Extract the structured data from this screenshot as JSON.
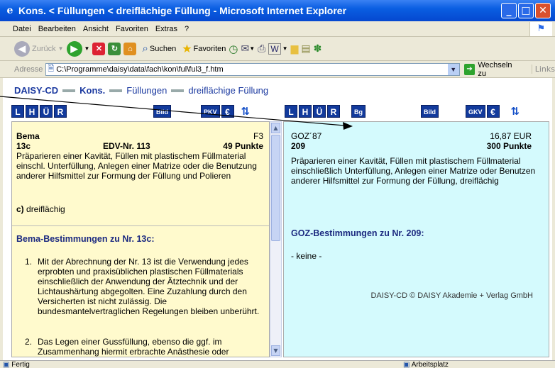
{
  "window": {
    "title": "Kons. < Füllungen < dreiflächige Füllung - Microsoft Internet Explorer"
  },
  "menu": [
    "Datei",
    "Bearbeiten",
    "Ansicht",
    "Favoriten",
    "Extras",
    "?"
  ],
  "toolbar": {
    "back": "Zurück",
    "search": "Suchen",
    "favorites": "Favoriten"
  },
  "address": {
    "label": "Adresse",
    "value": "C:\\Programme\\daisy\\data\\fach\\kon\\ful\\ful3_f.htm",
    "go": "Wechseln zu",
    "links": "Links"
  },
  "breadcrumb": {
    "root": "DAISY-CD",
    "b1": "Kons.",
    "b2": "Füllungen",
    "b3": "dreiflächige Füllung"
  },
  "left_nav": {
    "b1": "L",
    "b2": "H",
    "b3": "Ü",
    "b4": "R",
    "bild": "Bild",
    "pkv": "PKV",
    "euro": "€"
  },
  "right_nav": {
    "b1": "L",
    "b2": "H",
    "b3": "Ü",
    "b4": "R",
    "bg": "Bg",
    "bild": "Bild",
    "gkv": "GKV",
    "euro": "€"
  },
  "left": {
    "heading": "Bema",
    "code_right": "F3",
    "nr": "13c",
    "edv": "EDV-Nr. 113",
    "points": "49 Punkte",
    "desc": "Präparieren einer Kavität, Füllen mit plastischem Füllmaterial einschl. Unterfüllung, Anlegen einer Matrize oder die Benutzung anderer Hilfsmittel zur Formung der Füllung und Polieren",
    "sub_c": "c)",
    "sub_text": "dreiflächig",
    "bestimmungen": "Bema-Bestimmungen zu Nr. 13c:",
    "item1_num": "1.",
    "item1": "Mit der Abrechnung der Nr. 13 ist die Verwendung jedes erprobten und praxisüblichen plastischen Füllmaterials einschließlich der Anwendung der Ätztechnik und der Lichtaushärtung abgegolten. Eine Zuzahlung durch den Versicherten ist nicht zulässig. Die bundesmantelvertraglichen Regelungen bleiben unberührt.",
    "item2_num": "2.",
    "item2": "Das Legen einer Gussfüllung, ebenso die ggf. im Zusammenhang hiermit erbrachte Anästhesie oder"
  },
  "right": {
    "heading": "GOZ´87",
    "price": "16,87 EUR",
    "nr": "209",
    "points": "300 Punkte",
    "desc": "Präparieren einer Kavität, Füllen mit plastischem Füllmaterial einschließlich Unterfüllung, Anlegen einer Matrize oder Benutzen anderer Hilfsmittel zur Formung der Füllung, dreiflächig",
    "bestimmungen": "GOZ-Bestimmungen zu Nr. 209:",
    "keine": "- keine -",
    "footer": "DAISY-CD © DAISY Akademie + Verlag GmbH"
  },
  "status": {
    "left": "Fertig",
    "right": "Arbeitsplatz"
  }
}
